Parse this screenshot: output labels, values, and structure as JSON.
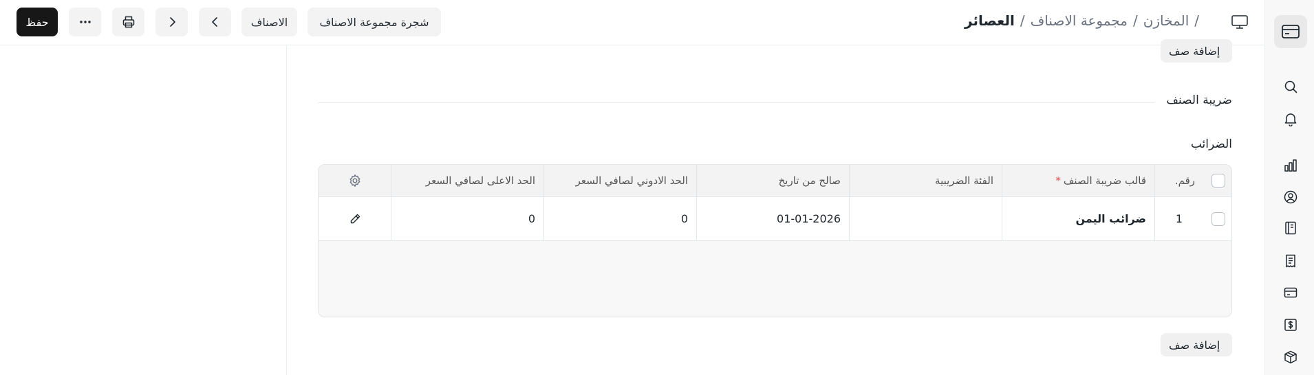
{
  "toolbar": {
    "save_label": "حفظ",
    "more_icon": "ellipsis-icon",
    "print_icon": "printer-icon",
    "next_icon": "chevron-right-icon",
    "prev_icon": "chevron-left-icon",
    "items_label": "الاصناف",
    "tree_label": "شجرة مجموعة الاصناف"
  },
  "breadcrumb": {
    "items": [
      "المخازن",
      "مجموعة الاصناف"
    ],
    "current": "العصائر",
    "separator": "/"
  },
  "sidebar": {
    "icons": [
      "app-card-icon",
      "search-icon",
      "bell-icon",
      "chart-icon",
      "user-circle-icon",
      "notebook-icon",
      "receipt-icon",
      "card-icon",
      "dollar-icon",
      "box-icon"
    ]
  },
  "form": {
    "add_row_label": "إضافة صف",
    "section_title": "ضريبة الصنف",
    "taxes_label": "الضرائب",
    "table": {
      "columns": {
        "no": "رقم.",
        "template": "قالب ضريبة الصنف",
        "required_mark": "*",
        "category": "الفئة الضريبية",
        "valid_from": "صالح من تاريخ",
        "min_net_rate": "الحد الادوني لصافي السعر",
        "max_net_rate": "الحد الاعلى لصافي السعر"
      },
      "rows": [
        {
          "no": "1",
          "template": "ضرائب اليمن",
          "category": "",
          "valid_from": "01-01-2026",
          "min_net_rate": "0",
          "max_net_rate": "0"
        }
      ]
    }
  },
  "colors": {
    "save_bg": "#171717",
    "button_bg": "#f3f3f3",
    "required": "#e24c4c",
    "border": "#e2e6e9"
  }
}
